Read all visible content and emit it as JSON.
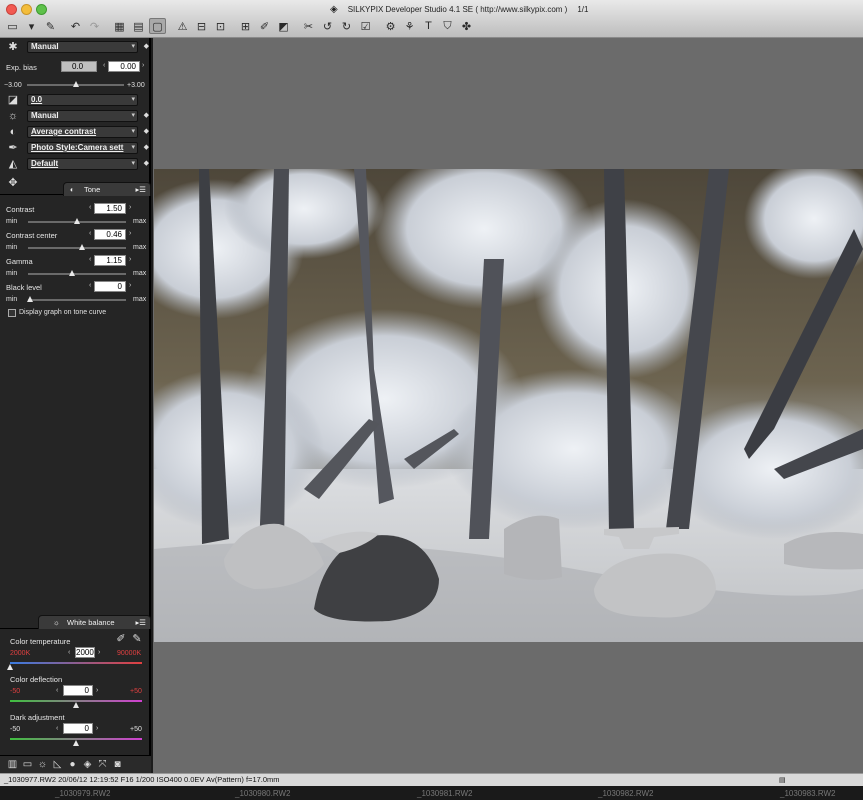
{
  "window": {
    "title": "SILKYPIX Developer Studio 4.1 SE ( http://www.silkypix.com )",
    "counter": "1/1"
  },
  "toolbar": {
    "icons": [
      "open-folder-icon",
      "open-menu-icon",
      "eraser-icon",
      "undo-icon",
      "redo-icon",
      "grid-view-icon",
      "preview-view-icon",
      "single-view-icon",
      "warning-icon",
      "crop-icon",
      "spot-icon",
      "grid-overlay-icon",
      "wb-dropper-icon",
      "compare-icon",
      "rotate-left-icon",
      "rotate-right-icon",
      "check-icon",
      "develop-icon",
      "batch-icon",
      "text-tool-icon",
      "shield-icon",
      "puzzle-icon"
    ]
  },
  "develop": {
    "exposure_mode": "Manual",
    "exp_bias_label": "Exp. bias",
    "exp_bias_left": "0.0",
    "exp_bias_value": "0.00",
    "exp_min": "−3.00",
    "exp_max": "+3.00",
    "exp_bias_level": 0.5,
    "rows": [
      {
        "icon": "exposure-icon",
        "value": "0.0"
      },
      {
        "icon": "sun-icon",
        "value": "Manual"
      },
      {
        "icon": "contrast-icon",
        "value": "Average contrast"
      },
      {
        "icon": "pen-icon",
        "value": "Photo Style:Camera sett"
      },
      {
        "icon": "color-icon",
        "value": "Default"
      }
    ]
  },
  "tone": {
    "title": "Tone",
    "sliders": [
      {
        "label": "Contrast",
        "value": "1.50",
        "level": 0.5
      },
      {
        "label": "Contrast center",
        "value": "0.46",
        "level": 0.55
      },
      {
        "label": "Gamma",
        "value": "1.15",
        "level": 0.45
      },
      {
        "label": "Black level",
        "value": "0",
        "level": 0.02
      }
    ],
    "min_label": "min",
    "max_label": "max",
    "checkbox_label": "Display graph on tone curve"
  },
  "white_balance": {
    "title": "White balance",
    "temp_label": "Color temperature",
    "temp_min": "2000K",
    "temp_value": "2000",
    "temp_max": "90000K",
    "temp_level": 0.0,
    "deflection_label": "Color deflection",
    "def_min": "-50",
    "def_value": "0",
    "def_max": "+50",
    "def_level": 0.5,
    "dark_label": "Dark adjustment",
    "dark_min": "-50",
    "dark_value": "0",
    "dark_max": "+50",
    "dark_level": 0.5,
    "colors": {
      "temp_left": "#3a7be0",
      "temp_right": "#e04040",
      "def_left": "#3fbf3f",
      "def_right": "#d040d0"
    }
  },
  "status": {
    "text": "_1030977.RW2 20/06/12 12:19:52 F16 1/200 ISO400  0.0EV Av(Pattern) f=17.0mm"
  },
  "filmstrip": {
    "items": [
      "_1030979.RW2",
      "_1030980.RW2",
      "_1030981.RW2",
      "_1030982.RW2",
      "_1030983.RW2"
    ]
  }
}
